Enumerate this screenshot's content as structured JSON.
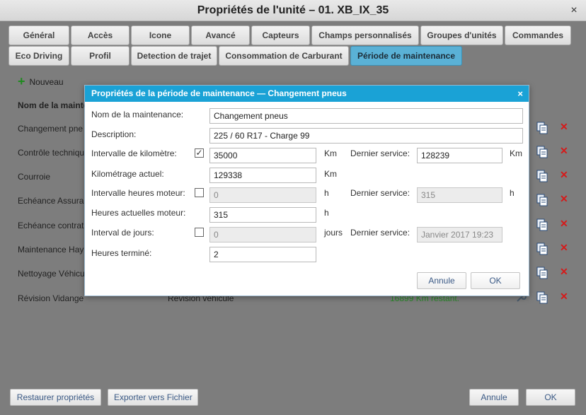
{
  "window": {
    "title": "Propriétés de l'unité – 01. XB_IX_35",
    "close_glyph": "×"
  },
  "tabs_row1": [
    {
      "label": "Général"
    },
    {
      "label": "Accès"
    },
    {
      "label": "Icone"
    },
    {
      "label": "Avancé"
    },
    {
      "label": "Capteurs"
    },
    {
      "label": "Champs personnalisés"
    },
    {
      "label": "Groupes d'unités"
    },
    {
      "label": "Commandes"
    }
  ],
  "tabs_row2": [
    {
      "label": "Eco Driving"
    },
    {
      "label": "Profil"
    },
    {
      "label": "Detection de trajet"
    },
    {
      "label": "Consommation de Carburant"
    },
    {
      "label": "Période de maintenance",
      "active": true
    }
  ],
  "toolbar": {
    "new_label": "Nouveau"
  },
  "list": {
    "header_name": "Nom de la mainte",
    "rows": [
      {
        "name": "Changement pne",
        "description": "",
        "remaining": ""
      },
      {
        "name": "Contrôle technique",
        "description": "",
        "remaining": ""
      },
      {
        "name": "Courroie",
        "description": "",
        "remaining": ""
      },
      {
        "name": "Echéance Assura",
        "description": "",
        "remaining": ""
      },
      {
        "name": "Echéance contrat",
        "description": "",
        "remaining": ""
      },
      {
        "name": "Maintenance Hay",
        "description": "",
        "remaining": ""
      },
      {
        "name": "Nettoyage Véhicu",
        "description": "",
        "remaining": ""
      },
      {
        "name": "Révision Vidange",
        "description": "Révision véhicule",
        "remaining": "16899 Km restant."
      }
    ]
  },
  "footer": {
    "restore_label": "Restaurer propriétés",
    "export_label": "Exporter vers Fichier",
    "cancel_label": "Annule",
    "ok_label": "OK"
  },
  "modal": {
    "title": "Propriétés de la période de maintenance — Changement pneus",
    "close_glyph": "×",
    "name_label": "Nom de la maintenance:",
    "name_value": "Changement pneus",
    "description_label": "Description:",
    "description_value": "225 / 60 R17 - Charge 99",
    "km_interval_label": "Intervalle de kilomètre:",
    "km_interval_checked": true,
    "km_interval_value": "35000",
    "km_unit": "Km",
    "km_last_service_label": "Dernier service:",
    "km_last_service_value": "128239",
    "km_last_service_unit": "Km",
    "current_km_label": "Kilométrage actuel:",
    "current_km_value": "129338",
    "current_km_unit": "Km",
    "engine_hours_interval_label": "Intervalle heures moteur:",
    "engine_hours_interval_checked": false,
    "engine_hours_interval_value": "0",
    "hours_unit": "h",
    "engine_last_service_label": "Dernier service:",
    "engine_last_service_value": "315",
    "engine_last_service_unit": "h",
    "current_engine_hours_label": "Heures actuelles moteur:",
    "current_engine_hours_value": "315",
    "current_engine_hours_unit": "h",
    "days_interval_label": "Interval de jours:",
    "days_interval_checked": false,
    "days_interval_value": "0",
    "days_unit": "jours",
    "days_last_service_label": "Dernier service:",
    "days_last_service_value": "Janvier 2017 19:23",
    "hours_done_label": "Heures terminé:",
    "hours_done_value": "2",
    "cancel_label": "Annule",
    "ok_label": "OK",
    "check_glyph": "✓"
  },
  "colors": {
    "modal_title_bg": "#1aa2d6",
    "active_tab_bg": "#5ab1d6",
    "delete_red": "#d61a1a",
    "remaining_green": "#2a8a2a",
    "add_green": "#1f8a1f"
  }
}
